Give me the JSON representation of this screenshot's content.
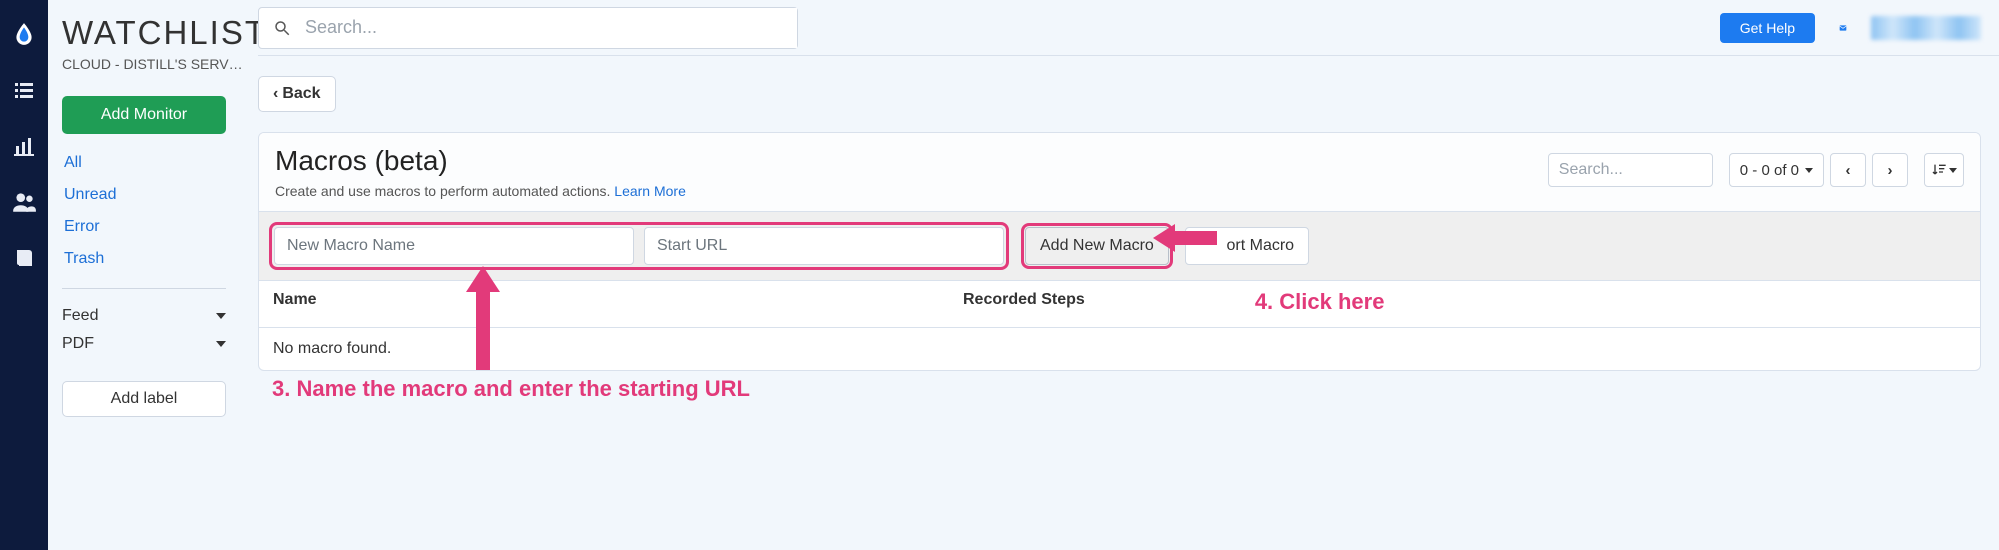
{
  "sidebar": {
    "title": "WATCHLIST",
    "subtitle": "CLOUD - DISTILL'S SERV…",
    "add_monitor": "Add Monitor",
    "links": [
      "All",
      "Unread",
      "Error",
      "Trash"
    ],
    "dropdowns": [
      "Feed",
      "PDF"
    ],
    "add_label": "Add label"
  },
  "topbar": {
    "search_placeholder": "Search...",
    "get_help": "Get Help"
  },
  "back_label": "Back",
  "macros": {
    "title": "Macros (beta)",
    "desc": "Create and use macros to perform automated actions. ",
    "learn_more": "Learn More",
    "search_placeholder": "Search...",
    "pager_range": "0 - 0 of 0",
    "name_placeholder": "New Macro Name",
    "url_placeholder": "Start URL",
    "add_btn": "Add New Macro",
    "import_btn": "Import Macro",
    "col_name": "Name",
    "col_steps": "Recorded Steps",
    "empty": "No macro found."
  },
  "annotations": {
    "step3": "3. Name the macro and enter the starting URL",
    "step4": "4. Click here"
  }
}
